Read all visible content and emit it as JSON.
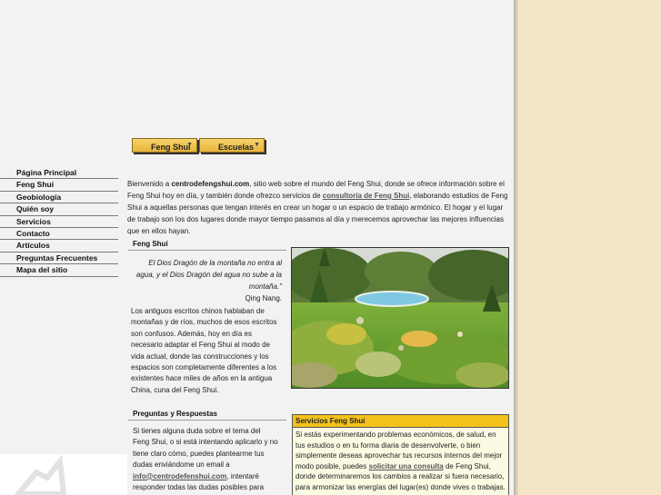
{
  "topnav": {
    "tabs": [
      {
        "label": "Feng Shui"
      },
      {
        "label": "Escuelas"
      }
    ]
  },
  "leftnav": {
    "items": [
      {
        "label": "Página Principal"
      },
      {
        "label": "Feng Shui"
      },
      {
        "label": "Geobiología"
      },
      {
        "label": "Quién soy"
      },
      {
        "label": "Servicios"
      },
      {
        "label": "Contacto"
      },
      {
        "label": "Artículos"
      },
      {
        "label": "Preguntas Frecuentes"
      },
      {
        "label": "Mapa del sitio"
      }
    ]
  },
  "intro": {
    "p1": "Bienvenido a ",
    "site": "centrodefengshui.com",
    "p2": ", sitio web sobre el mundo del Feng Shui, donde se ofrece información sobre el Feng Shui hoy en día, y también donde ofrezco servicios de ",
    "link": "consultoría de Feng Shui",
    "p3": ", elaborando estudios de Feng Shui a aquellas personas que tengan interés en crear un hogar o un espacio de trabajo armónico. El hogar y el lugar de trabajo son los dos lugares donde mayor tiempo pasamos al día y merecemos aprovechar las mejores influencias que en ellos hayan."
  },
  "fengshui": {
    "title": "Feng Shui",
    "quote": "El Dios Dragón de la montaña no entra al agua, y el Dios Dragón del agua no sube a la montaña.\"",
    "quote_author": "Qing Nang.",
    "body": "Los antiguos escritos chinos hablaban de montañas y de ríos, muchos de esos escritos son confusos. Además, hoy en día es necesario adaptar el Feng Shui al modo de vida actual, donde las construcciones y los espacios son completamente diferentes a los existentes hace miles de años en la antigua China, cuna del Feng Shui."
  },
  "faq": {
    "title": "Preguntas y Respuestas",
    "p1": "Si tienes alguna duda sobre el tema del Feng Shui, o si está intentando aplicarlo y no tiene claro cómo, puedes plantearme tus dudas enviándome un email a ",
    "email": "info@centrodefenshui.com",
    "p2": ", intentaré responder todas las dudas posibles para conseguir hacer Feng Shui."
  },
  "services": {
    "title": "Servicios Feng Shui",
    "p1": "Si estás experimentando problemas económicos, de salud, en tus estudios o en tu forma diaria de desenvolverte, o bien simplemente deseas aprovechar tus recursos internos del mejor modo posible, puedes ",
    "link": "solicitar una consulta",
    "p2": " de Feng Shui, donde determinaremos los cambios a realizar si fuera necesario, para armonizar las energías del lugar(es) donde vives o trabajas."
  },
  "photo": {
    "icon": "garden-photo"
  },
  "colors": {
    "accent": "#f4c21a",
    "page_bg": "#f2f2f2",
    "outer_bg": "#f5e6c8"
  }
}
